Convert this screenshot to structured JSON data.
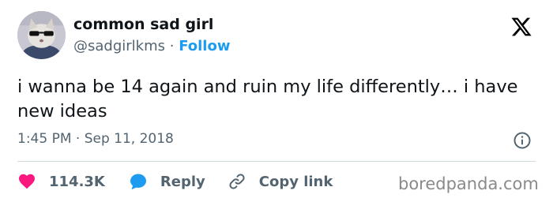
{
  "author": {
    "display_name": "common sad girl",
    "handle": "@sadgirlkms",
    "separator": "·",
    "follow_label": "Follow",
    "avatar_icon": "cat-with-sunglasses-avatar"
  },
  "platform": {
    "logo_icon": "x-logo-icon"
  },
  "tweet": {
    "text": "i wanna be 14 again and ruin my life differently… i have new ideas",
    "timestamp": "1:45 PM · Sep 11, 2018"
  },
  "actions": {
    "likes_count": "114.3K",
    "reply_label": "Reply",
    "copy_link_label": "Copy link"
  },
  "watermark": {
    "text": "boredpanda.com"
  },
  "colors": {
    "link_blue": "#1d9bf0",
    "heart_red": "#f91880",
    "secondary_text": "#536471",
    "primary_text": "#0f1419"
  }
}
